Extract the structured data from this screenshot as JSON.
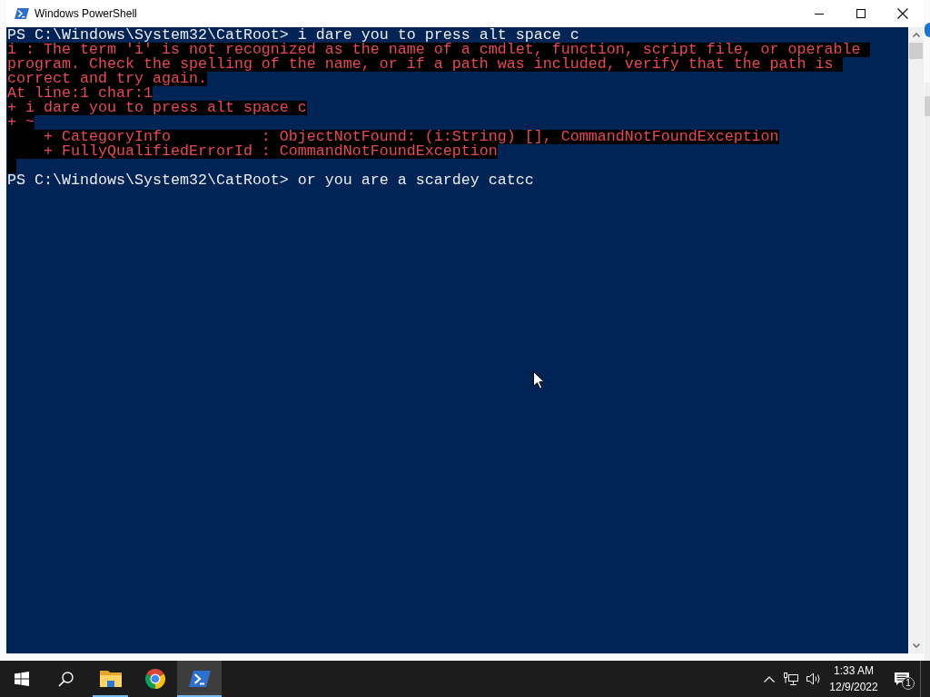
{
  "window": {
    "title": "Windows PowerShell"
  },
  "console": {
    "lines": [
      {
        "kind": "input",
        "text": "PS C:\\Windows\\System32\\CatRoot> i dare you to press alt space c"
      },
      {
        "kind": "error",
        "text": "i : The term 'i' is not recognized as the name of a cmdlet, function, script file, or operable "
      },
      {
        "kind": "error",
        "text": "program. Check the spelling of the name, or if a path was included, verify that the path is "
      },
      {
        "kind": "error",
        "text": "correct and try again."
      },
      {
        "kind": "error",
        "text": "At line:1 char:1"
      },
      {
        "kind": "error",
        "text": "+ i dare you to press alt space c"
      },
      {
        "kind": "error",
        "text": "+ ~"
      },
      {
        "kind": "error",
        "text": "    + CategoryInfo          : ObjectNotFound: (i:String) [], CommandNotFoundException"
      },
      {
        "kind": "error",
        "text": "    + FullyQualifiedErrorId : CommandNotFoundException"
      },
      {
        "kind": "error_gap"
      },
      {
        "kind": "input",
        "text": "PS C:\\Windows\\System32\\CatRoot> or you are a scardey catcc"
      }
    ]
  },
  "taskbar": {
    "apps": [
      {
        "kind": "folder",
        "running": true,
        "selected": false
      },
      {
        "kind": "browser",
        "running": false,
        "selected": false
      },
      {
        "kind": "powershell",
        "running": true,
        "selected": true
      }
    ],
    "clock": {
      "time": "1:33 AM",
      "date": "12/9/2022"
    },
    "notifications": {
      "count": "1"
    }
  }
}
